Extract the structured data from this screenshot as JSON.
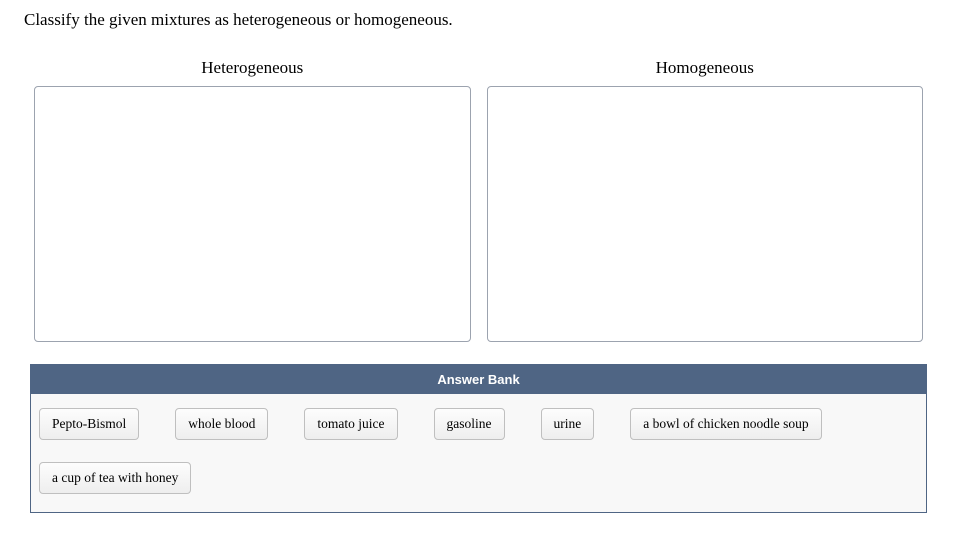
{
  "question": "Classify the given mixtures as heterogeneous or homogeneous.",
  "zones": {
    "left_title": "Heterogeneous",
    "right_title": "Homogeneous"
  },
  "answer_bank": {
    "header": "Answer Bank",
    "items": [
      "Pepto-Bismol",
      "whole blood",
      "tomato juice",
      "gasoline",
      "urine",
      "a bowl of chicken noodle soup",
      "a cup of tea with honey"
    ]
  }
}
